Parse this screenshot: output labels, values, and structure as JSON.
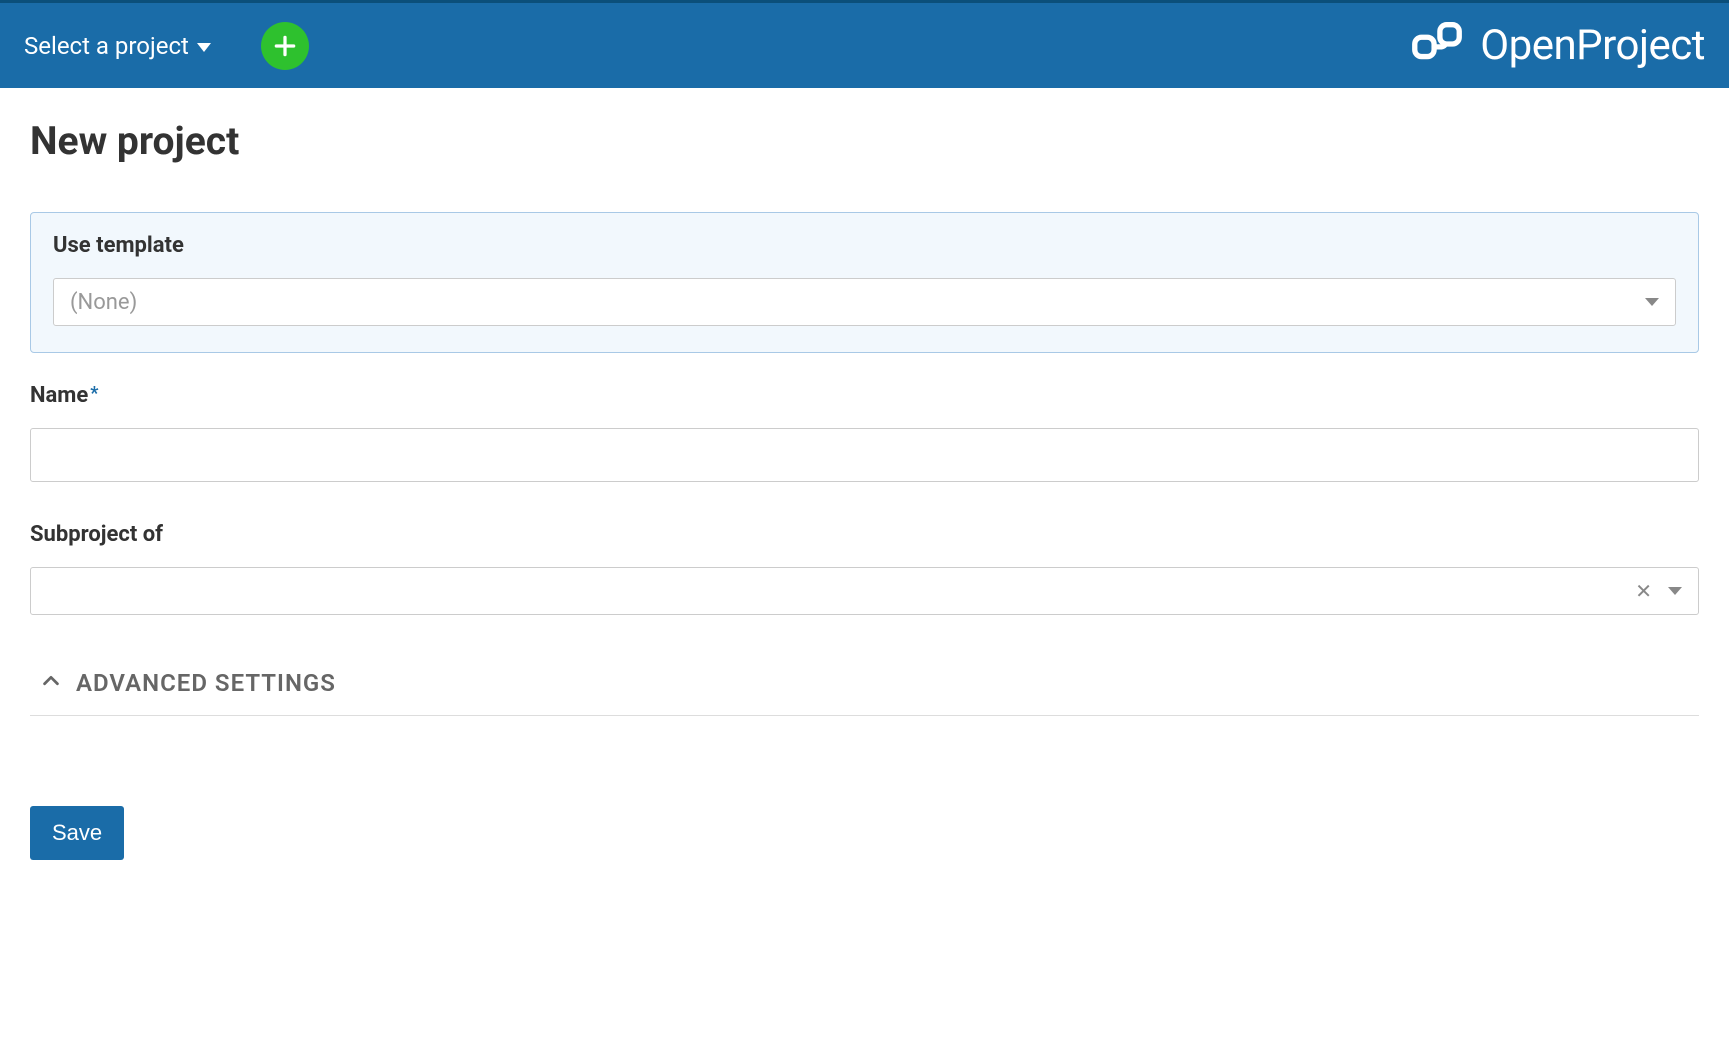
{
  "header": {
    "project_selector_label": "Select a project",
    "brand_name": "OpenProject"
  },
  "page": {
    "title": "New project"
  },
  "form": {
    "template_label": "Use template",
    "template_placeholder": "(None)",
    "name_label": "Name",
    "name_value": "",
    "subproject_label": "Subproject of",
    "subproject_value": "",
    "advanced_label": "ADVANCED SETTINGS",
    "save_button_label": "Save"
  }
}
